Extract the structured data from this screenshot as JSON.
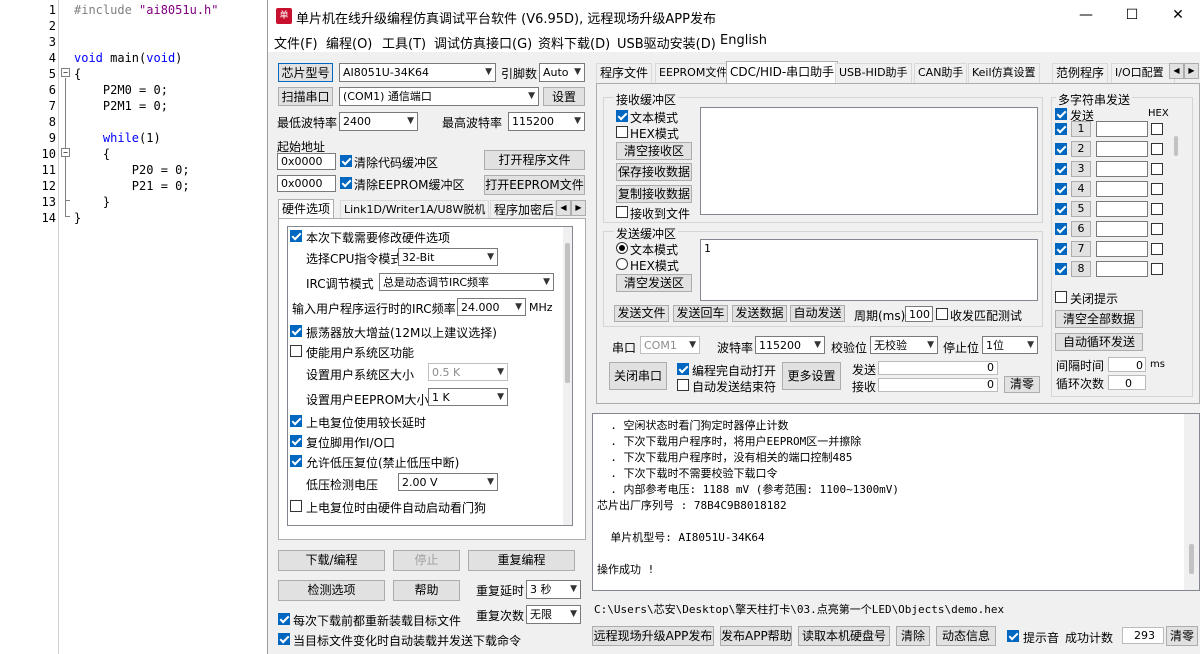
{
  "editor": {
    "lines": [
      {
        "n": "1",
        "code": "#include \"ai8051u.h\""
      },
      {
        "n": "2",
        "code": ""
      },
      {
        "n": "3",
        "code": ""
      },
      {
        "n": "4",
        "code": "void main(void)"
      },
      {
        "n": "5",
        "code": "{"
      },
      {
        "n": "6",
        "code": "    P2M0 = 0;"
      },
      {
        "n": "7",
        "code": "    P2M1 = 0;"
      },
      {
        "n": "8",
        "code": ""
      },
      {
        "n": "9",
        "code": "    while(1)"
      },
      {
        "n": "10",
        "code": "    {"
      },
      {
        "n": "11",
        "code": "        P20 = 0;"
      },
      {
        "n": "12",
        "code": "        P21 = 0;"
      },
      {
        "n": "13",
        "code": "    }"
      },
      {
        "n": "14",
        "code": "}"
      }
    ]
  },
  "window": {
    "title": "单片机在线升级编程仿真调试平台软件 (V6.95D), 远程现场升级APP发布",
    "min": "—",
    "max": "☐",
    "close": "✕"
  },
  "menu": [
    "文件(F)",
    "编程(O)",
    "工具(T)",
    "调试仿真接口(G)",
    "资料下载(D)",
    "USB驱动安装(D)",
    "English"
  ],
  "left": {
    "chip_btn": "芯片型号",
    "chip_value": "AI8051U-34K64",
    "pins_label": "引脚数",
    "pins_value": "Auto",
    "scan_btn": "扫描串口",
    "port_value": "(COM1) 通信端口",
    "settings_btn": "设置",
    "min_baud_label": "最低波特率",
    "min_baud_value": "2400",
    "max_baud_label": "最高波特率",
    "max_baud_value": "115200",
    "start_addr_label": "起始地址",
    "addr1": "0x0000",
    "clear_code": "清除代码缓冲区",
    "open_prog": "打开程序文件",
    "addr2": "0x0000",
    "clear_eeprom": "清除EEPROM缓冲区",
    "open_eeprom": "打开EEPROM文件",
    "tabs": [
      "硬件选项",
      "Link1D/Writer1A/U8W脱机",
      "程序加密后"
    ],
    "hw": {
      "modify": "本次下载需要修改硬件选项",
      "cpu_mode_label": "选择CPU指令模式",
      "cpu_mode_value": "32-Bit",
      "irc_label": "IRC调节模式",
      "irc_value": "总是动态调节IRC频率",
      "irc_freq_label": "输入用户程序运行时的IRC频率",
      "irc_freq_value": "24.000",
      "mhz": "MHz",
      "osc_gain": "振荡器放大增益(12M以上建议选择)",
      "user_sys": "使能用户系统区功能",
      "sys_size_label": "设置用户系统区大小",
      "sys_size_value": "0.5 K",
      "eeprom_size_label": "设置用户EEPROM大小",
      "eeprom_size_value": "1   K",
      "long_delay": "上电复位使用较长延时",
      "reset_io": "复位脚用作I/O口",
      "low_volt_reset": "允许低压复位(禁止低压中断)",
      "low_volt_label": "低压检测电压",
      "low_volt_value": "2.00 V",
      "watchdog": "上电复位时由硬件自动启动看门狗"
    },
    "download_btn": "下载/编程",
    "stop_btn": "停止",
    "repeat_btn": "重复编程",
    "check_btn": "检测选项",
    "help_btn": "帮助",
    "repeat_delay_label": "重复延时",
    "repeat_delay_value": "3 秒",
    "repeat_count_label": "重复次数",
    "repeat_count_value": "无限",
    "reload_each": "每次下载前都重新装载目标文件",
    "auto_reload": "当目标文件变化时自动装载并发送下载命令"
  },
  "right": {
    "tabs": [
      "程序文件",
      "EEPROM文件",
      "CDC/HID-串口助手",
      "USB-HID助手",
      "CAN助手",
      "Keil仿真设置",
      "范例程序",
      "I/O口配置"
    ],
    "recv_title": "接收缓冲区",
    "recv_text_mode": "文本模式",
    "recv_hex_mode": "HEX模式",
    "clear_recv": "清空接收区",
    "save_recv": "保存接收数据",
    "copy_recv": "复制接收数据",
    "recv_to_file": "接收到文件",
    "send_title": "发送缓冲区",
    "send_text_mode": "文本模式",
    "send_hex_mode": "HEX模式",
    "clear_send": "清空发送区",
    "send_content": "1",
    "send_file": "发送文件",
    "send_cr": "发送回车",
    "send_data": "发送数据",
    "auto_send": "自动发送",
    "period_label": "周期(ms)",
    "period_value": "100",
    "match_test": "收发匹配测试",
    "multi_title": "多字符串发送",
    "multi_send": "发送",
    "hex": "HEX",
    "rows": [
      "1",
      "2",
      "3",
      "4",
      "5",
      "6",
      "7",
      "8"
    ],
    "close_tip": "关闭提示",
    "clear_all": "清空全部数据",
    "auto_loop": "自动循环发送",
    "interval_label": "间隔时间",
    "interval_value": "0",
    "ms": "ms",
    "loop_label": "循环次数",
    "loop_value": "0",
    "port_label": "串口",
    "port_value": "COM1",
    "baud_label": "波特率",
    "baud_value": "115200",
    "parity_label": "校验位",
    "parity_value": "无校验",
    "stop_label": "停止位",
    "stop_value": "1位",
    "close_port": "关闭串口",
    "auto_open": "编程完自动打开",
    "auto_send_end": "自动发送结束符",
    "more_settings": "更多设置",
    "send_label": "发送",
    "send_count": "0",
    "recv_label": "接收",
    "recv_count": "0",
    "clear_count": "清零"
  },
  "log": [
    "  . 空闲状态时看门狗定时器停止计数",
    "  . 下次下载用户程序时，将用户EEPROM区一并擦除",
    "  . 下次下载用户程序时，没有相关的端口控制485",
    "  . 下次下载时不需要校验下载口令",
    "  . 内部参考电压: 1188 mV (参考范围: 1100~1300mV)",
    "芯片出厂序列号 : 78B4C9B8018182",
    "",
    "  单片机型号: AI8051U-34K64",
    "",
    "操作成功 !"
  ],
  "path": "C:\\Users\\芯安\\Desktop\\擎天柱打卡\\03.点亮第一个LED\\Objects\\demo.hex",
  "bottom": {
    "remote_app": "远程现场升级APP发布",
    "app_help": "发布APP帮助",
    "read_disk": "读取本机硬盘号",
    "clear": "清除",
    "anim": "动态信息",
    "beep": "提示音",
    "success_label": "成功计数",
    "success_value": "293",
    "clear_zero": "清零"
  }
}
